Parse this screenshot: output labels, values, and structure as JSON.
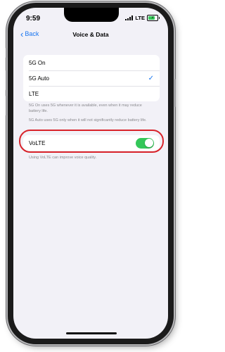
{
  "status": {
    "time": "9:59",
    "network": "LTE"
  },
  "nav": {
    "back": "Back",
    "title": "Voice & Data"
  },
  "options": [
    {
      "label": "5G On",
      "selected": false
    },
    {
      "label": "5G Auto",
      "selected": true
    },
    {
      "label": "LTE",
      "selected": false
    }
  ],
  "footer": {
    "on": "5G On uses 5G whenever it is available, even when it may reduce battery life.",
    "auto": "5G Auto uses 5G only when it will not significantly reduce battery life."
  },
  "volte": {
    "label": "VoLTE",
    "enabled": true,
    "footer": "Using VoLTE can improve voice quality."
  },
  "colors": {
    "accent": "#1976f0",
    "toggle_on": "#34c759",
    "highlight": "#d8232a",
    "background": "#f2f1f7"
  }
}
